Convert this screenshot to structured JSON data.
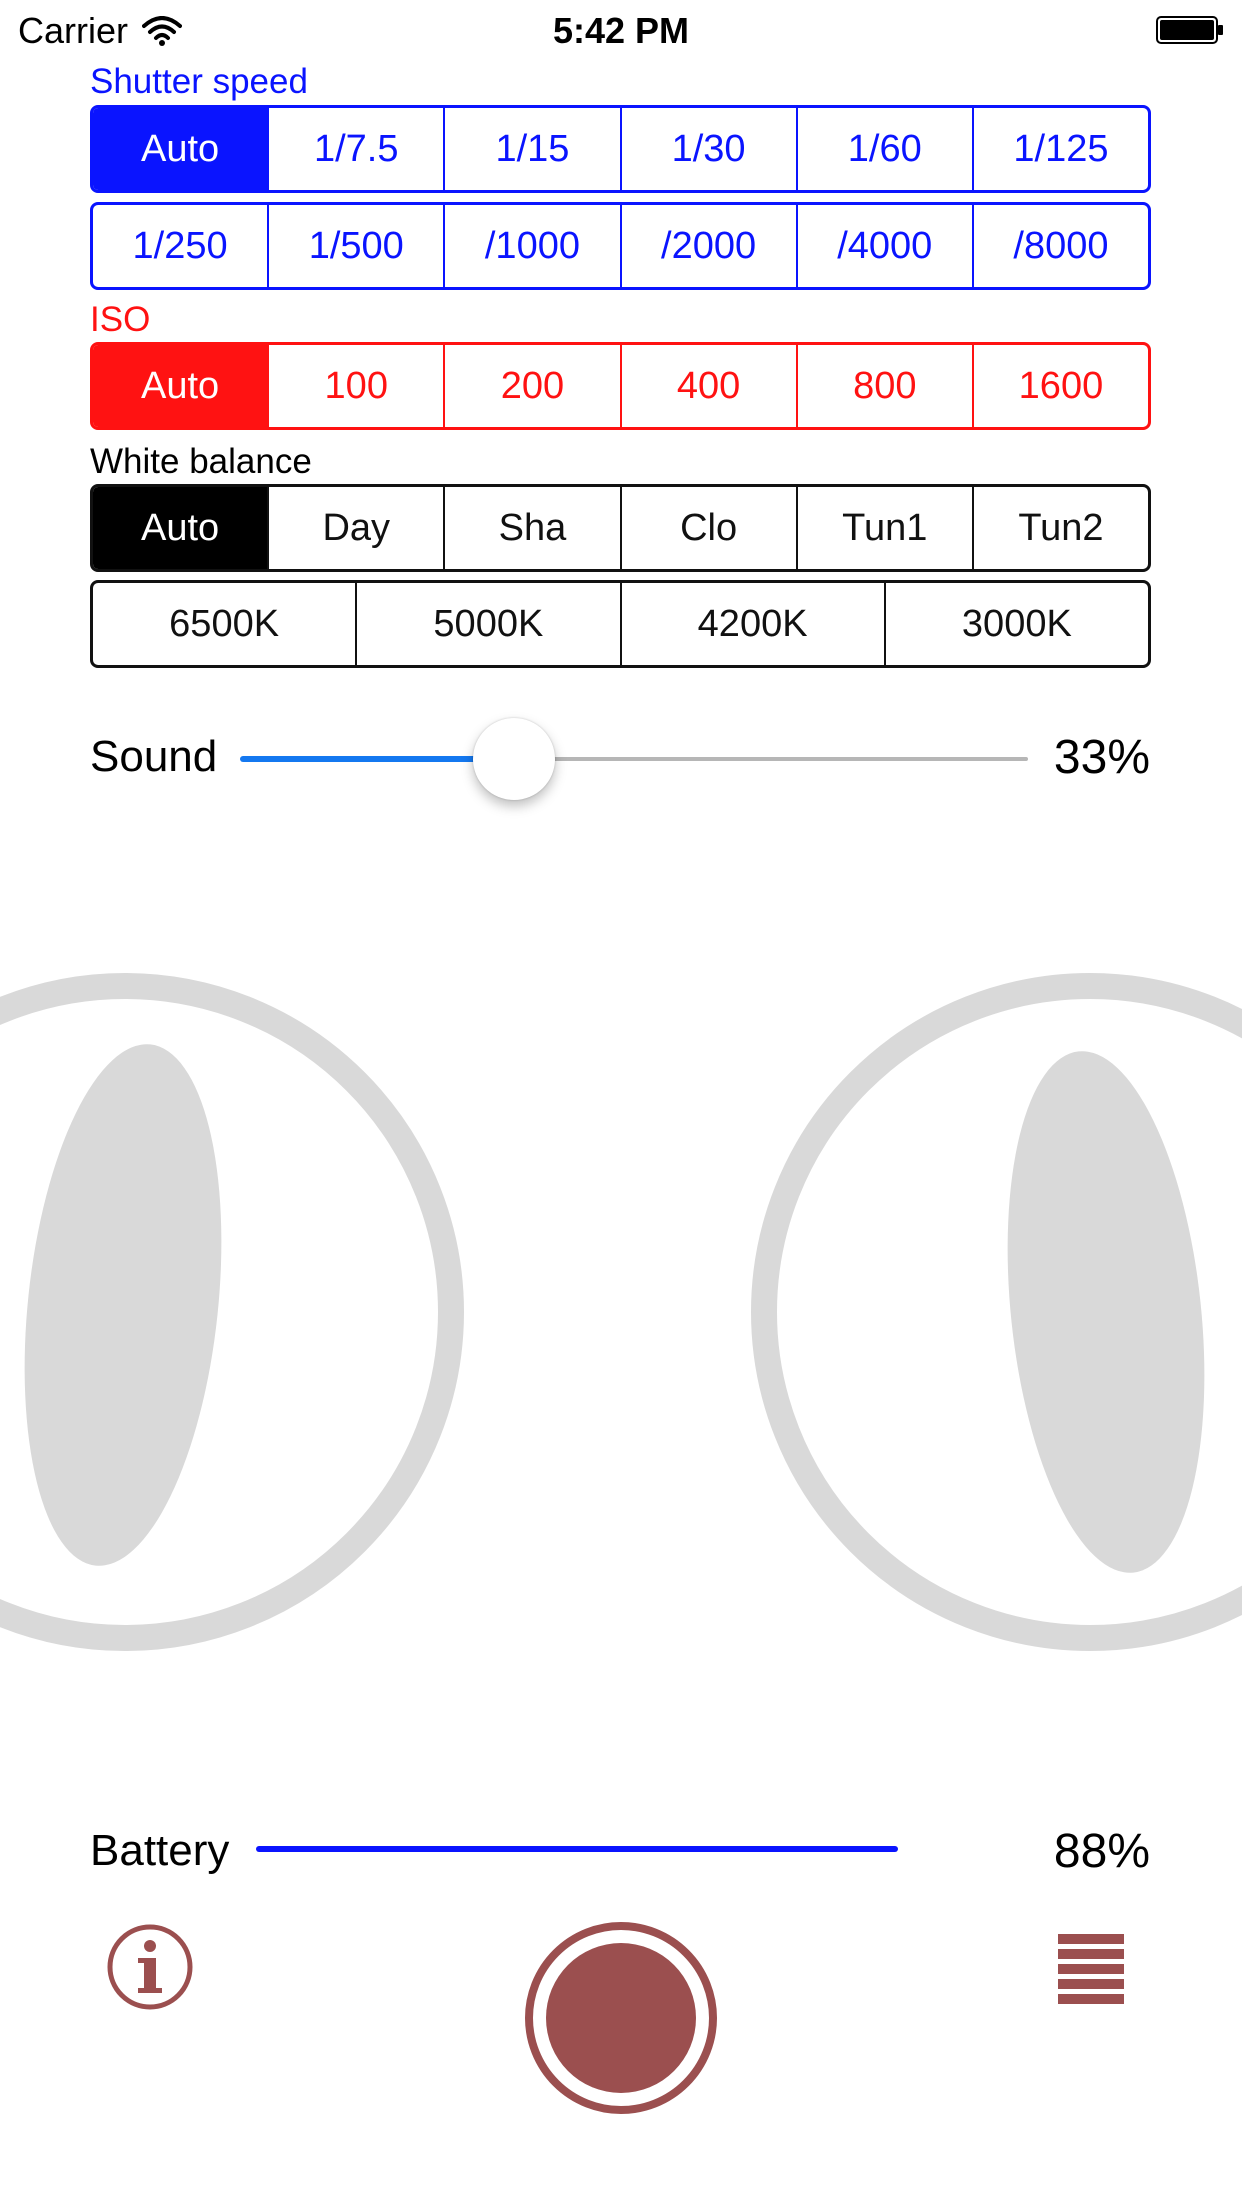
{
  "status_bar": {
    "carrier": "Carrier",
    "time": "5:42 PM"
  },
  "shutter": {
    "label": "Shutter speed",
    "row1": [
      "Auto",
      "1/7.5",
      "1/15",
      "1/30",
      "1/60",
      "1/125"
    ],
    "row2": [
      "1/250",
      "1/500",
      "/1000",
      "/2000",
      "/4000",
      "/8000"
    ],
    "selected": "Auto",
    "color": "#0a14ff"
  },
  "iso": {
    "label": "ISO",
    "options": [
      "Auto",
      "100",
      "200",
      "400",
      "800",
      "1600"
    ],
    "selected": "Auto",
    "color": "#ff1212"
  },
  "white_balance": {
    "label": "White balance",
    "row1": [
      "Auto",
      "Day",
      "Sha",
      "Clo",
      "Tun1",
      "Tun2"
    ],
    "row2": [
      "6500K",
      "5000K",
      "4200K",
      "3000K"
    ],
    "selected": "Auto"
  },
  "sound": {
    "label": "Sound",
    "value_text": "33%",
    "value": 0.33,
    "color": "#1478f0"
  },
  "battery": {
    "label": "Battery",
    "value_text": "88%",
    "color": "#0a14ff"
  },
  "icons": {
    "info": "info-icon",
    "record": "record-button",
    "menu": "menu-icon",
    "eyes": "cat-eyes-graphic"
  },
  "accent_color": "#9b4f4f"
}
